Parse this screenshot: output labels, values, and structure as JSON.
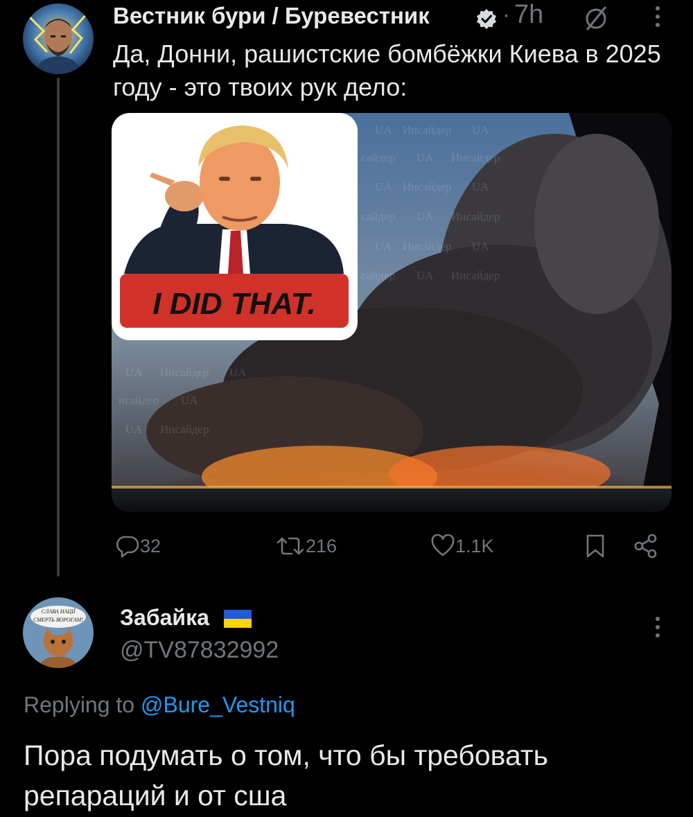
{
  "tweet": {
    "author_name": "Вестник бури / Буревестник",
    "verified_icon": "verified-badge-icon",
    "separator": "·",
    "time": "7h",
    "text": "Да, Донни, рашистские бомбёжки Киева в 2025 году - это твоих рук дело:",
    "media": {
      "sticker_text": "I DID THAT.",
      "watermark_text": "Инсайдер UA"
    },
    "actions": {
      "replies": "32",
      "retweets": "216",
      "likes": "1.1K"
    }
  },
  "reply": {
    "author_name": "Забайка",
    "flag_icon": "ukraine-flag-icon",
    "handle": "@TV87832992",
    "avatar_text_1": "СЛАВА НАЦІЇ",
    "avatar_text_2": "СМЕРТЬ ВОРОГАМ!",
    "replying_prefix": "Replying to",
    "replying_to": "@Bure_Vestniq",
    "text": "Пора подумать о том, что бы требовать репараций и от сша"
  },
  "colors": {
    "background": "#000000",
    "text": "#e7e9ea",
    "muted": "#71767b",
    "link": "#1d9bf0",
    "verified": "#1d9bf0",
    "sticker_red": "#d0322a"
  }
}
